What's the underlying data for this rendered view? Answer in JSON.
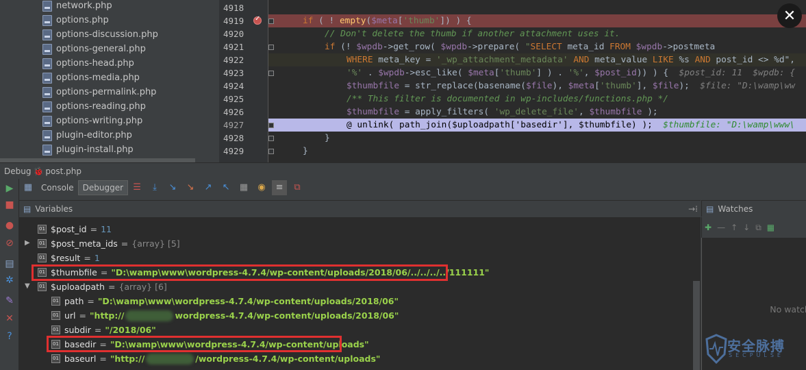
{
  "tree": {
    "files": [
      "network.php",
      "options.php",
      "options-discussion.php",
      "options-general.php",
      "options-head.php",
      "options-media.php",
      "options-permalink.php",
      "options-reading.php",
      "options-writing.php",
      "plugin-editor.php",
      "plugin-install.php"
    ]
  },
  "editor": {
    "line_numbers": [
      "4918",
      "4919",
      "4920",
      "4921",
      "4922",
      "4923",
      "4924",
      "4925",
      "4926",
      "4927",
      "4928",
      "4929"
    ],
    "lines": [
      [],
      [
        [
          "kw",
          "if"
        ],
        [
          "txt",
          " ( ! "
        ],
        [
          "fn",
          "empty"
        ],
        [
          "txt",
          "("
        ],
        [
          "var",
          "$meta"
        ],
        [
          "txt",
          "["
        ],
        [
          "str",
          "'thumb'"
        ],
        [
          "txt",
          "]) ) {"
        ]
      ],
      [
        [
          "cm",
          "// Don't delete the thumb if another attachment uses it."
        ]
      ],
      [
        [
          "kw",
          "if"
        ],
        [
          "txt",
          " (! "
        ],
        [
          "var",
          "$wpdb"
        ],
        [
          "txt",
          "->get_row( "
        ],
        [
          "var",
          "$wpdb"
        ],
        [
          "txt",
          "->prepare( "
        ],
        [
          "str",
          "\""
        ],
        [
          "sqlkw",
          "SELECT"
        ],
        [
          "txt",
          " meta_id "
        ],
        [
          "sqlkw",
          "FROM"
        ],
        [
          "txt",
          " "
        ],
        [
          "var",
          "$wpdb"
        ],
        [
          "txt",
          "->postmeta"
        ]
      ],
      [
        [
          "sqlkw",
          "WHERE"
        ],
        [
          "txt",
          " meta_key = "
        ],
        [
          "str",
          "'_wp_attachment_metadata'"
        ],
        [
          "txt",
          " "
        ],
        [
          "sqlkw",
          "AND"
        ],
        [
          "txt",
          " meta_value "
        ],
        [
          "sqlkw",
          "LIKE"
        ],
        [
          "txt",
          " %s "
        ],
        [
          "sqlkw",
          "AND"
        ],
        [
          "txt",
          " post_id <> %d\","
        ]
      ],
      [
        [
          "str",
          "'%'"
        ],
        [
          "txt",
          " . "
        ],
        [
          "var",
          "$wpdb"
        ],
        [
          "txt",
          "->esc_like( "
        ],
        [
          "var",
          "$meta"
        ],
        [
          "txt",
          "["
        ],
        [
          "str",
          "'thumb'"
        ],
        [
          "txt",
          "] ) . "
        ],
        [
          "str",
          "'%'"
        ],
        [
          "txt",
          ", "
        ],
        [
          "var",
          "$post_id"
        ],
        [
          "txt",
          ")) ) {  "
        ],
        [
          "cmv",
          "$post_id: 11  $wpdb: {"
        ]
      ],
      [
        [
          "var",
          "$thumbfile"
        ],
        [
          "txt",
          " = str_replace(basename("
        ],
        [
          "var",
          "$file"
        ],
        [
          "txt",
          "), "
        ],
        [
          "var",
          "$meta"
        ],
        [
          "txt",
          "["
        ],
        [
          "str",
          "'thumb'"
        ],
        [
          "txt",
          "], "
        ],
        [
          "var",
          "$file"
        ],
        [
          "txt",
          ");  "
        ],
        [
          "cmv",
          "$file: \"D:\\wamp\\ww"
        ]
      ],
      [
        [
          "cm",
          "/** This filter is documented in wp-includes/functions.php */"
        ]
      ],
      [
        [
          "var",
          "$thumbfile"
        ],
        [
          "txt",
          " = apply_filters( "
        ],
        [
          "str",
          "'wp_delete_file'"
        ],
        [
          "txt",
          ", "
        ],
        [
          "var",
          "$thumbfile"
        ],
        [
          "txt",
          " );"
        ]
      ],
      [
        [
          "txt",
          "@ unlink( path_join($uploadpath['basedir'], $thumbfile) );  "
        ],
        [
          "cmv",
          "$thumbfile: \"D:\\wamp\\www\\"
        ]
      ],
      [
        [
          "txt",
          "}"
        ]
      ],
      [
        [
          "txt",
          "}"
        ]
      ]
    ]
  },
  "debug": {
    "title": "Debug",
    "config": "post.php",
    "tabs": {
      "console": "Console",
      "debugger": "Debugger"
    }
  },
  "variables": {
    "header": "Variables",
    "rows": [
      {
        "name": "$post_id",
        "value": "11",
        "kind": "num"
      },
      {
        "name": "$post_meta_ids",
        "value": "{array} [5]",
        "kind": "gray",
        "expandable": true
      },
      {
        "name": "$result",
        "value": "1",
        "kind": "num"
      },
      {
        "name": "$thumbfile",
        "value": "\"D:\\wamp\\www\\wordpress-4.7.4/wp-content/uploads/2018/06/../../../../111111\"",
        "kind": "str"
      },
      {
        "name": "$uploadpath",
        "value": "{array} [6]",
        "kind": "gray",
        "expanded": true
      },
      {
        "name": "path",
        "value": "\"D:\\wamp\\www\\wordpress-4.7.4/wp-content/uploads/2018/06\"",
        "kind": "str",
        "child": true
      },
      {
        "name": "url",
        "value_pre": "\"http://",
        "value_post": "wordpress-4.7.4/wp-content/uploads/2018/06\"",
        "kind": "str",
        "child": true,
        "blurred": true
      },
      {
        "name": "subdir",
        "value": "\"/2018/06\"",
        "kind": "str",
        "child": true
      },
      {
        "name": "basedir",
        "value": "\"D:\\wamp\\www\\wordpress-4.7.4/wp-content/uploads\"",
        "kind": "str",
        "child": true
      },
      {
        "name": "baseurl",
        "value_pre": "\"http://",
        "value_post": "/wordpress-4.7.4/wp-content/uploads\"",
        "kind": "str",
        "child": true,
        "blurred": true
      }
    ]
  },
  "watches": {
    "header": "Watches",
    "empty_text": "No watches"
  },
  "watermark": {
    "title": "安全脉搏",
    "subtitle": "SECPULSE"
  }
}
